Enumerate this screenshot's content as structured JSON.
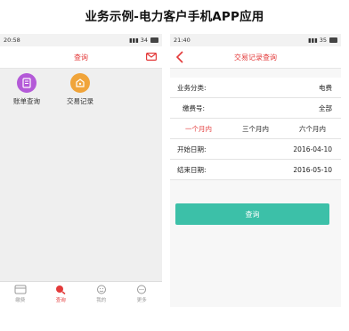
{
  "page": {
    "title": "业务示例-电力客户手机APP应用"
  },
  "left": {
    "status": {
      "time": "20:58",
      "battery": "34"
    },
    "nav": {
      "title": "查询"
    },
    "menu": [
      {
        "label": "账单查询",
        "icon": "bill-icon",
        "color": "#b45ad8"
      },
      {
        "label": "交易记录",
        "icon": "wallet-icon",
        "color": "#f0a43a"
      }
    ],
    "tabs": [
      {
        "label": "缴费",
        "icon": "card-icon"
      },
      {
        "label": "查询",
        "icon": "search-icon",
        "active": true
      },
      {
        "label": "我的",
        "icon": "smile-icon"
      },
      {
        "label": "更多",
        "icon": "more-icon"
      }
    ]
  },
  "right": {
    "status": {
      "time": "21:40",
      "battery": "35"
    },
    "nav": {
      "title": "交易记录查询"
    },
    "form": {
      "category_label": "业务分类:",
      "category_value": "电费",
      "account_label": "缴费号:",
      "account_value": "全部",
      "periods": [
        "一个月内",
        "三个月内",
        "六个月内"
      ],
      "active_period": 0,
      "start_label": "开始日期:",
      "start_value": "2016-04-10",
      "end_label": "结束日期:",
      "end_value": "2016-05-10"
    },
    "button": {
      "label": "查询"
    }
  },
  "colors": {
    "accent": "#e33a3a",
    "button": "#3cc0a8"
  }
}
